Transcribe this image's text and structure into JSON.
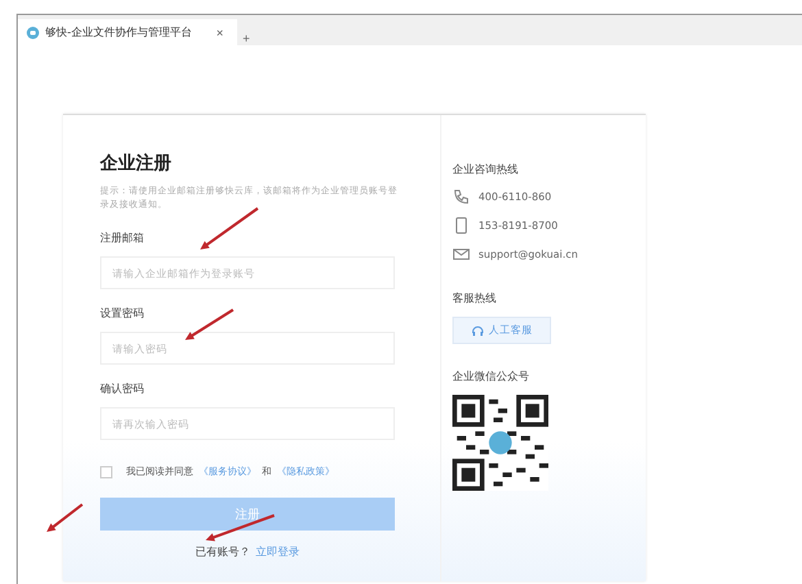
{
  "browser": {
    "tab_title": "够快-企业文件协作与管理平台",
    "new_tab": "+",
    "close": "×"
  },
  "form": {
    "title": "企业注册",
    "hint": "提示：请使用企业邮箱注册够快云库，该邮箱将作为企业管理员账号登录及接收通知。",
    "fields": [
      {
        "label": "注册邮箱",
        "placeholder": "请输入企业邮箱作为登录账号"
      },
      {
        "label": "设置密码",
        "placeholder": "请输入密码"
      },
      {
        "label": "确认密码",
        "placeholder": "请再次输入密码"
      }
    ],
    "agreement": {
      "checked": false,
      "text": "我已阅读并同意",
      "link1": "《服务协议》",
      "and": "和",
      "link2": "《隐私政策》"
    },
    "submit": {
      "label": "注册",
      "disabled": true
    },
    "login_prompt": "已有账号？",
    "login_link": "立即登录"
  },
  "contact": {
    "title": "企业咨询热线",
    "items": [
      {
        "kind": "phone",
        "text": "400-6110-860"
      },
      {
        "kind": "mobile",
        "text": "153-8191-8700"
      },
      {
        "kind": "mail",
        "text": "support@gokuai.cn"
      }
    ],
    "service_title": "客服热线",
    "service_button": "人工客服",
    "wechat_title": "企业微信公众号"
  }
}
